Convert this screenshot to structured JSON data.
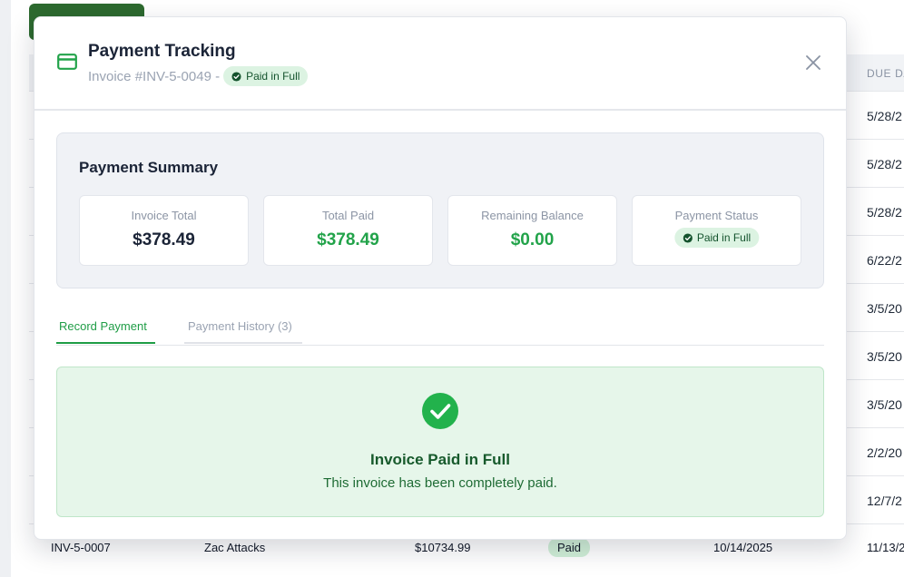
{
  "background": {
    "due_date_header": "DUE DA",
    "due_dates": [
      "5/28/2",
      "5/28/2",
      "5/28/2",
      "6/22/2",
      "3/5/20",
      "3/5/20",
      "3/5/20",
      "2/2/20",
      "12/7/2"
    ],
    "bottom_row": {
      "invoice": "INV-5-0007",
      "client": "Zac Attacks",
      "amount": "$10734.99",
      "status": "Paid",
      "issue_date": "10/14/2025",
      "due_date": "11/13/2"
    }
  },
  "modal": {
    "title": "Payment Tracking",
    "subtitle": "Invoice #INV-5-0049 -",
    "status_pill": "Paid in Full",
    "summary": {
      "title": "Payment Summary",
      "invoice_total_label": "Invoice Total",
      "invoice_total": "$378.49",
      "total_paid_label": "Total Paid",
      "total_paid": "$378.49",
      "remaining_label": "Remaining Balance",
      "remaining": "$0.00",
      "status_label": "Payment Status",
      "status": "Paid in Full"
    },
    "tabs": {
      "record": "Record Payment",
      "history": "Payment History (3)"
    },
    "success": {
      "title": "Invoice Paid in Full",
      "message": "This invoice has been completely paid."
    }
  },
  "colors": {
    "accent_green": "#22a34a",
    "dark_green_button": "#2d6a2f",
    "success_bg": "#e6f6ea"
  },
  "icons": {
    "card": "credit-card-icon",
    "close": "close-icon",
    "check_small": "check-circle-icon",
    "check_large": "check-circle-large-icon"
  }
}
